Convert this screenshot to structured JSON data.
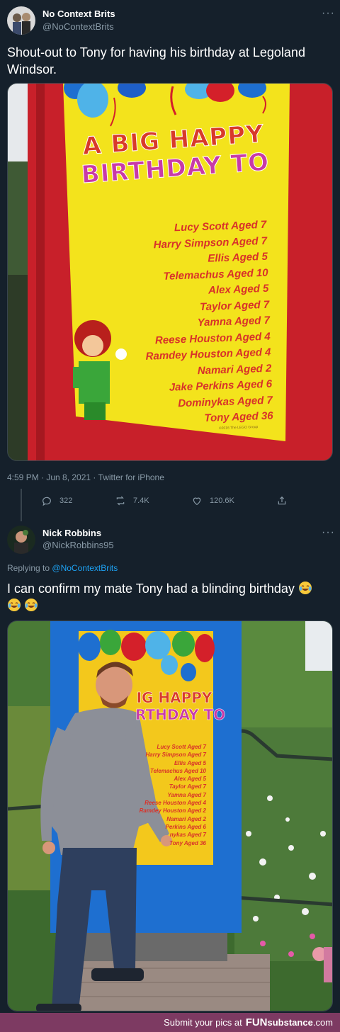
{
  "tweet1": {
    "name": "No Context Brits",
    "handle": "@NoContextBrits",
    "more_label": "···",
    "text": "Shout-out to Tony for having his birthday at Legoland Windsor.",
    "timestamp": "4:59 PM · Jun 8, 2021 · Twitter for iPhone",
    "replies": "322",
    "retweets": "7.4K",
    "likes": "120.6K"
  },
  "sign1": {
    "heading_line1": "A BIG HAPPY",
    "heading_line2": "BIRTHDAY TO",
    "names": [
      "Lucy Scott Aged 7",
      "Harry Simpson Aged 7",
      "Ellis Aged 5",
      "Telemachus Aged 10",
      "Alex Aged 5",
      "Taylor Aged 7",
      "Yamna Aged 7",
      "Reese Houston Aged 4",
      "Ramdey Houston Aged 4",
      "Namari Aged 2",
      "Jake Perkins Aged 6",
      "Dominykas Aged 7",
      "Tony Aged 36"
    ],
    "copyright": "©2016 The LEGO Group"
  },
  "tweet2": {
    "name": "Nick Robbins",
    "handle": "@NickRobbins95",
    "more_label": "···",
    "replying_prefix": "Replying to",
    "replying_handle": "@NoContextBrits",
    "text": "I can confirm my mate Tony had a blinding birthday"
  },
  "sign2": {
    "heading_line1": "IG HAPPY",
    "heading_line2": "RTHDAY TO",
    "names": [
      "Lucy Scott Aged 7",
      "Harry Simpson Aged 7",
      "Ellis Aged 5",
      "Telemachus Aged 10",
      "Alex Aged 5",
      "Taylor Aged 7",
      "Yamna Aged 7",
      "Reese Houston Aged 4",
      "Ramdey Houston Aged 2",
      "Namari Aged 2",
      "Perkins Aged 6",
      "nykas Aged 7",
      "Tony Aged 36"
    ]
  },
  "footer": {
    "text": "Submit your pics at",
    "brand_fun": "FUN",
    "brand_rest": "substance",
    "brand_domain": ".com"
  },
  "colors": {
    "background": "#15202b",
    "muted": "#8899a6",
    "link": "#1da1f2",
    "footer_bg": "#7d3a62",
    "sign_yellow": "#f3e31c",
    "sign_frame_red": "#c8202a",
    "sign_frame_blue": "#1e6fd0"
  }
}
